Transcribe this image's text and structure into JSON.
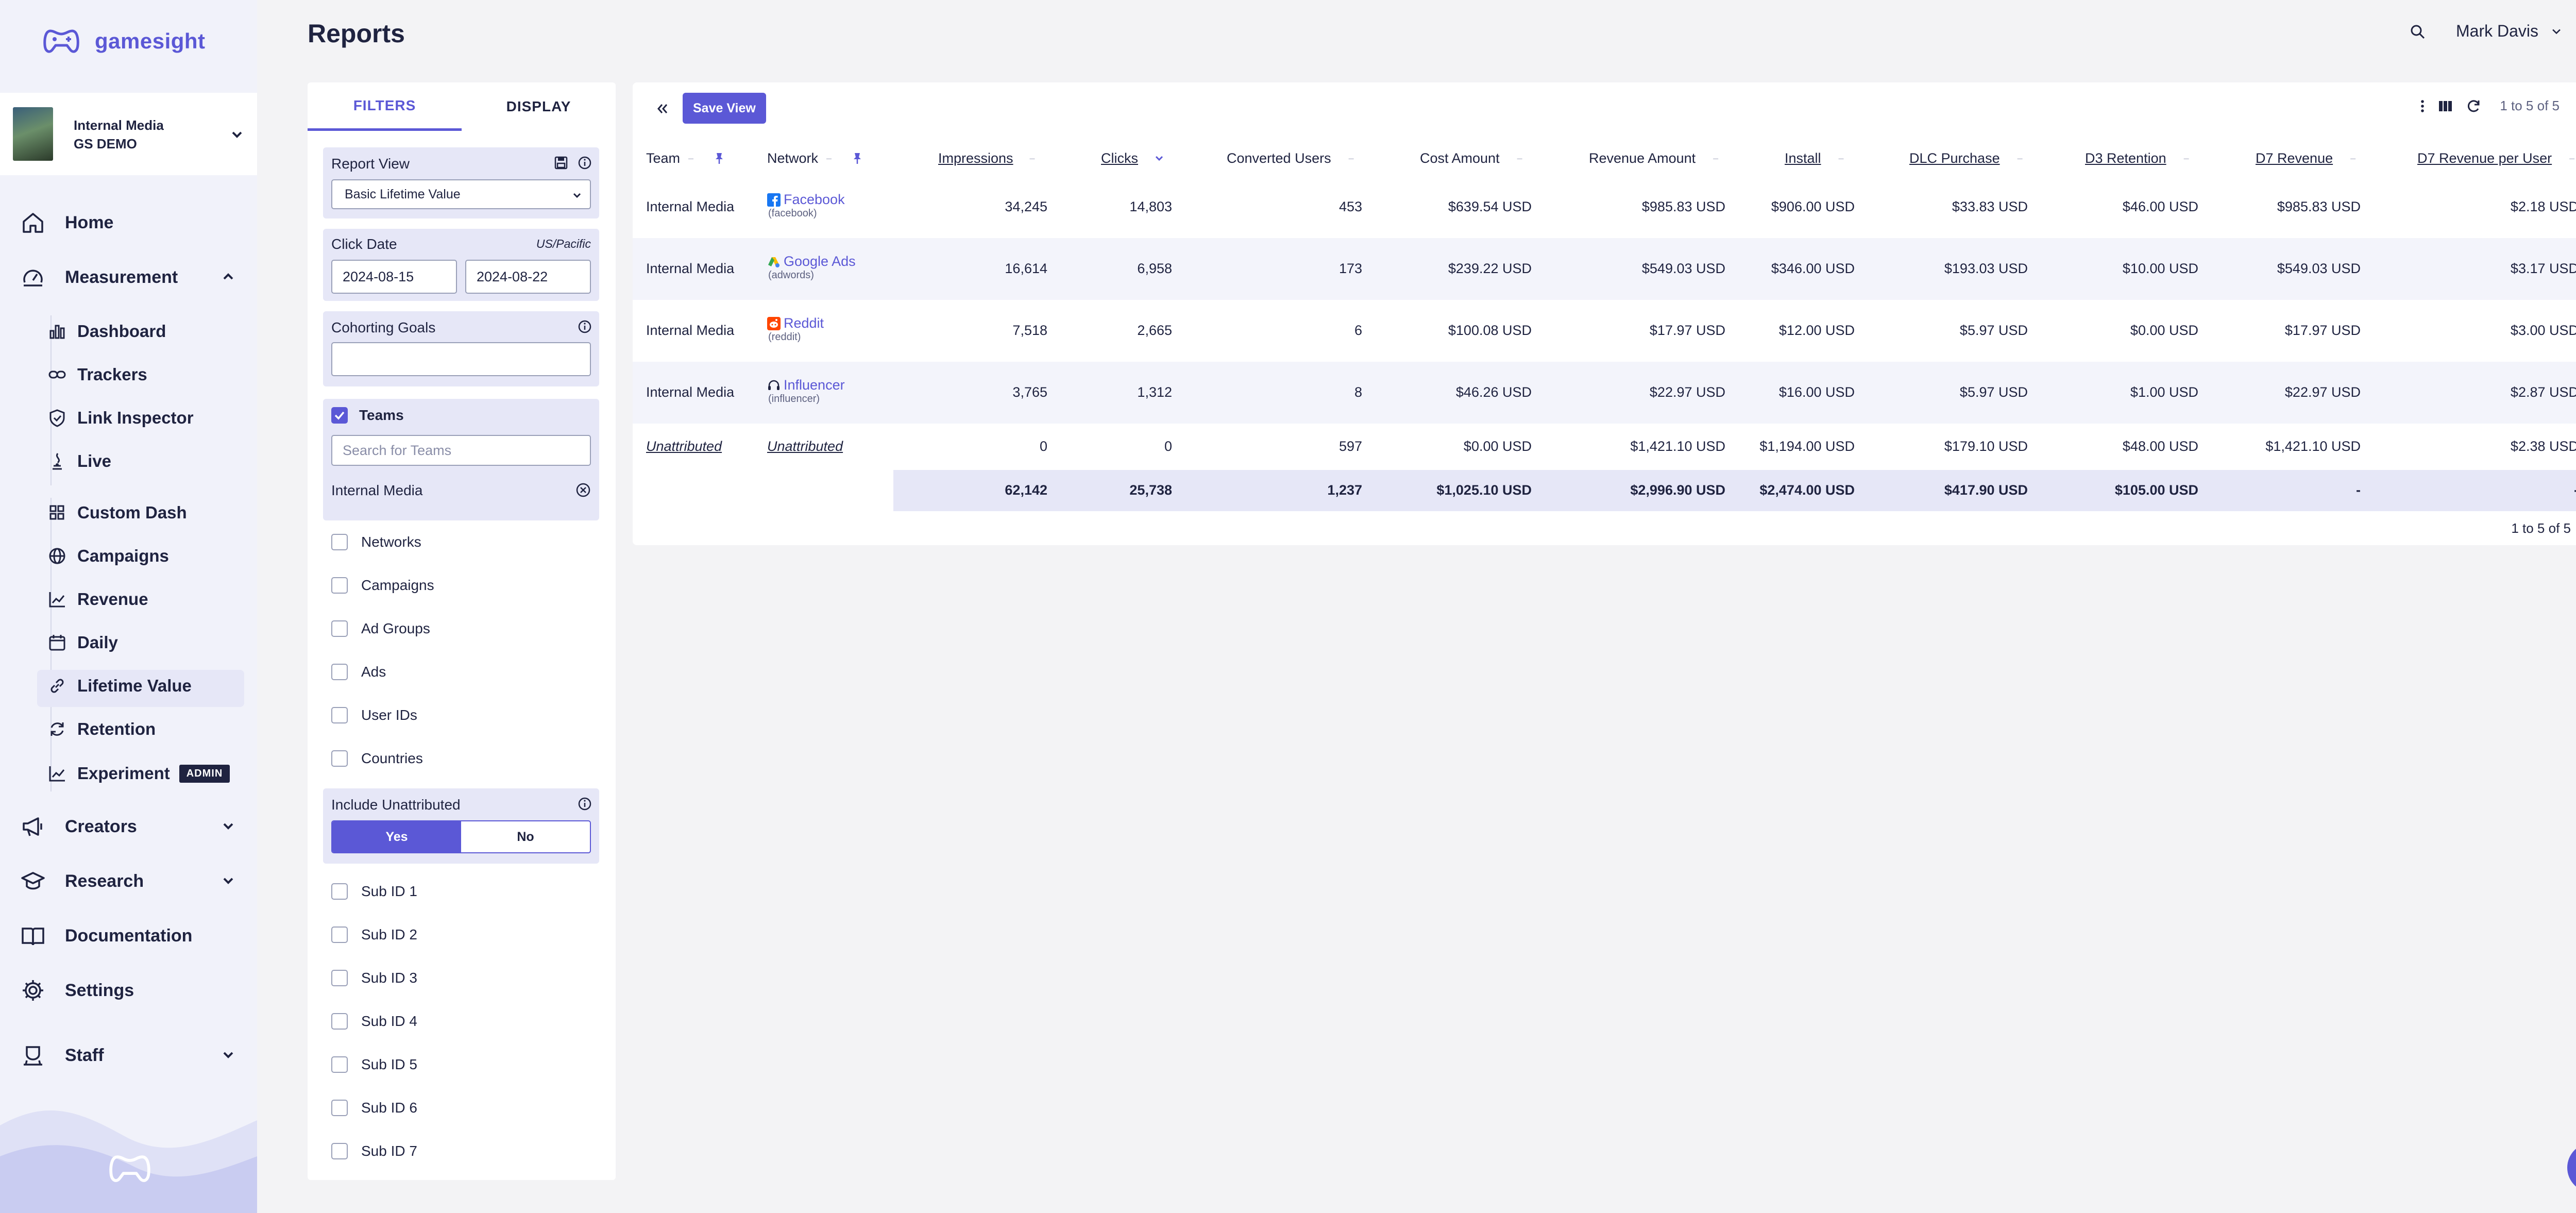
{
  "app": {
    "name": "gamesight",
    "brand_color": "#5b58d6",
    "text_color": "#1f2340"
  },
  "org": {
    "name": "Internal Media",
    "subtitle": "GS DEMO"
  },
  "nav": {
    "home": "Home",
    "measurement": "Measurement",
    "measurement_items": [
      {
        "label": "Dashboard",
        "icon": "dashboard-icon"
      },
      {
        "label": "Trackers",
        "icon": "link-icon"
      },
      {
        "label": "Link Inspector",
        "icon": "shield-icon"
      },
      {
        "label": "Live",
        "icon": "live-icon"
      },
      {
        "label": "Custom Dash",
        "icon": "grid-icon"
      },
      {
        "label": "Campaigns",
        "icon": "globe-icon"
      },
      {
        "label": "Revenue",
        "icon": "chart-line-icon"
      },
      {
        "label": "Daily",
        "icon": "calendar-icon"
      },
      {
        "label": "Lifetime Value",
        "icon": "link-icon"
      },
      {
        "label": "Retention",
        "icon": "refresh-icon"
      },
      {
        "label": "Experiment",
        "icon": "chart-line-icon",
        "badge": "ADMIN"
      }
    ],
    "creators": "Creators",
    "research": "Research",
    "documentation": "Documentation",
    "settings": "Settings",
    "staff": "Staff",
    "active": "Lifetime Value"
  },
  "header": {
    "title": "Reports",
    "user": "Mark Davis"
  },
  "filters": {
    "tab_filters": "FILTERS",
    "tab_display": "DISPLAY",
    "report_view_label": "Report View",
    "report_view_value": "Basic Lifetime Value",
    "click_date_label": "Click Date",
    "timezone": "US/Pacific",
    "date_start": "2024-08-15",
    "date_end": "2024-08-22",
    "cohorting_label": "Cohorting Goals",
    "cohorting_value": "",
    "teams_label": "Teams",
    "teams_search_placeholder": "Search for Teams",
    "teams_selected": "Internal Media",
    "group_options": [
      "Networks",
      "Campaigns",
      "Ad Groups",
      "Ads",
      "User IDs",
      "Countries"
    ],
    "include_unattributed_label": "Include Unattributed",
    "yes": "Yes",
    "no": "No",
    "include_unattributed": "Yes",
    "sub_ids": [
      "Sub ID 1",
      "Sub ID 2",
      "Sub ID 3",
      "Sub ID 4",
      "Sub ID 5",
      "Sub ID 6",
      "Sub ID 7"
    ]
  },
  "toolbar": {
    "save_view": "Save View",
    "pager": "1 to 5 of 5"
  },
  "table": {
    "columns": [
      "Team",
      "Network",
      "Impressions",
      "Clicks",
      "Converted Users",
      "Cost Amount",
      "Revenue Amount",
      "Install",
      "DLC Purchase",
      "D3 Retention",
      "D7 Revenue",
      "D7 Revenue per User"
    ],
    "rows": [
      {
        "team": "Internal Media",
        "network": "Facebook",
        "network_id": "(facebook)",
        "icon": "facebook-icon",
        "values": [
          "34,245",
          "14,803",
          "453",
          "$639.54 USD",
          "$985.83 USD",
          "$906.00 USD",
          "$33.83 USD",
          "$46.00 USD",
          "$985.83 USD",
          "$2.18 USD"
        ]
      },
      {
        "team": "Internal Media",
        "network": "Google Ads",
        "network_id": "(adwords)",
        "icon": "google-ads-icon",
        "values": [
          "16,614",
          "6,958",
          "173",
          "$239.22 USD",
          "$549.03 USD",
          "$346.00 USD",
          "$193.03 USD",
          "$10.00 USD",
          "$549.03 USD",
          "$3.17 USD"
        ]
      },
      {
        "team": "Internal Media",
        "network": "Reddit",
        "network_id": "(reddit)",
        "icon": "reddit-icon",
        "values": [
          "7,518",
          "2,665",
          "6",
          "$100.08 USD",
          "$17.97 USD",
          "$12.00 USD",
          "$5.97 USD",
          "$0.00 USD",
          "$17.97 USD",
          "$3.00 USD"
        ]
      },
      {
        "team": "Internal Media",
        "network": "Influencer",
        "network_id": "(influencer)",
        "icon": "headset-icon",
        "values": [
          "3,765",
          "1,312",
          "8",
          "$46.26 USD",
          "$22.97 USD",
          "$16.00 USD",
          "$5.97 USD",
          "$1.00 USD",
          "$22.97 USD",
          "$2.87 USD"
        ]
      },
      {
        "team": "Unattributed",
        "network": "Unattributed",
        "network_id": "",
        "icon": "",
        "values": [
          "0",
          "0",
          "597",
          "$0.00 USD",
          "$1,421.10 USD",
          "$1,194.00 USD",
          "$179.10 USD",
          "$48.00 USD",
          "$1,421.10 USD",
          "$2.38 USD"
        ]
      }
    ],
    "totals": [
      "62,142",
      "25,738",
      "1,237",
      "$1,025.10 USD",
      "$2,996.90 USD",
      "$2,474.00 USD",
      "$417.90 USD",
      "$105.00 USD",
      "-",
      "-"
    ]
  }
}
